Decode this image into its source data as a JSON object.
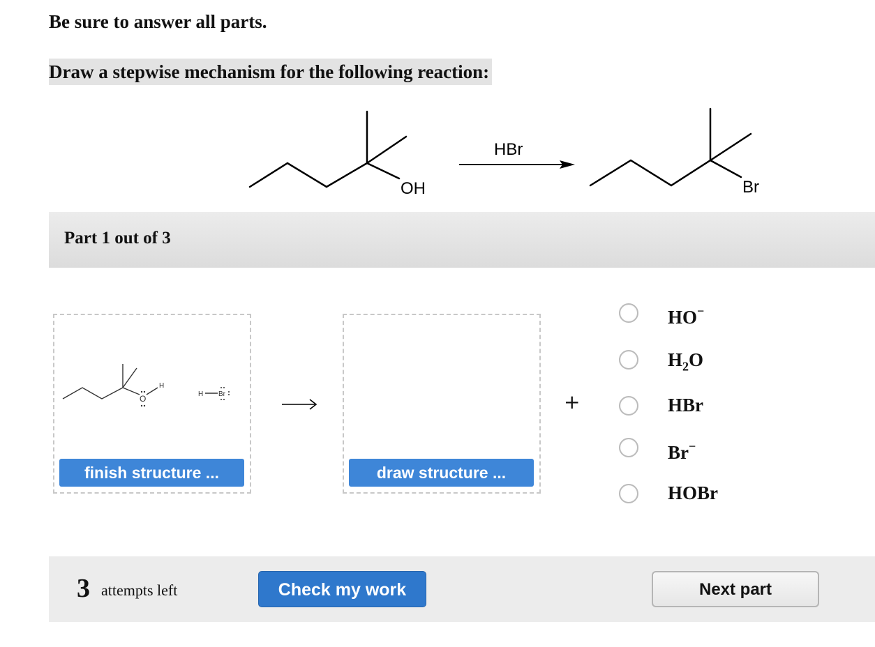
{
  "instruction": "Be sure to answer all parts.",
  "prompt": "Draw a stepwise mechanism for the following reaction:",
  "reaction": {
    "reagent": "HBr",
    "reactant_group": "OH",
    "product_group": "Br"
  },
  "part": {
    "label": "Part 1 out of 3"
  },
  "mechanism": {
    "atom_O": "O",
    "atom_H": "H",
    "hbr_H": "H",
    "hbr_Br": "Br",
    "finish_label": "finish structure ...",
    "draw_label": "draw structure ...",
    "plus": "+"
  },
  "options": [
    {
      "main": "HO",
      "sub": "",
      "tail": "",
      "charge": "−"
    },
    {
      "main": "H",
      "sub": "2",
      "tail": "O",
      "charge": ""
    },
    {
      "main": "HBr",
      "sub": "",
      "tail": "",
      "charge": ""
    },
    {
      "main": "Br",
      "sub": "",
      "tail": "",
      "charge": "−"
    },
    {
      "main": "HOBr",
      "sub": "",
      "tail": "",
      "charge": ""
    }
  ],
  "footer": {
    "attempts_count": "3",
    "attempts_text": "attempts left",
    "check_label": "Check my work",
    "next_label": "Next part"
  },
  "colors": {
    "accent": "#3e86d8",
    "check_button": "#2f78cc"
  }
}
